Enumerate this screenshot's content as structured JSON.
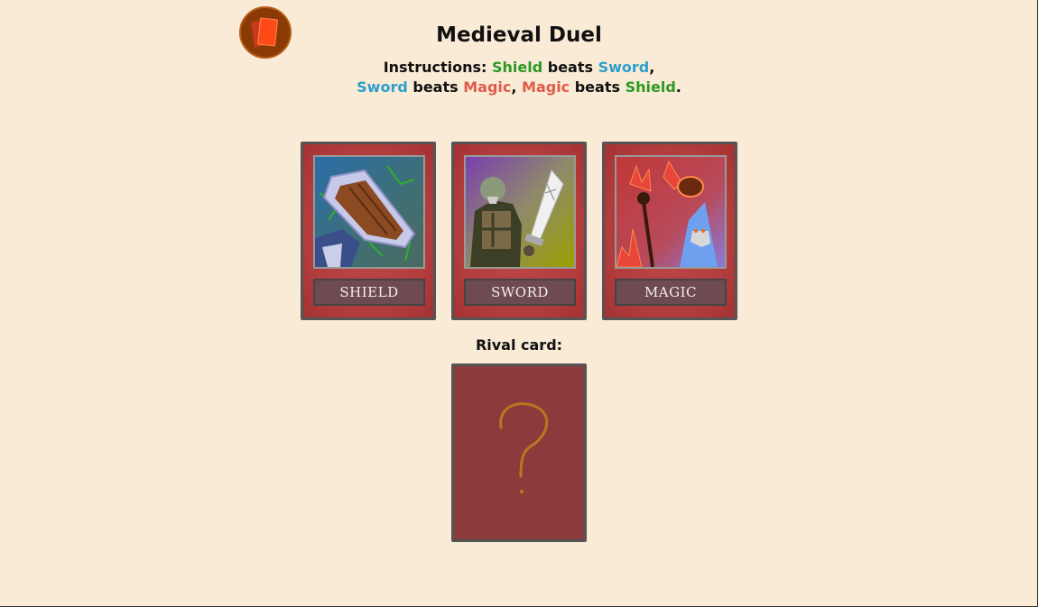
{
  "app": {
    "title": "Medieval Duel"
  },
  "instructions": {
    "prefix": "Instructions:",
    "line1": [
      {
        "text": "Shield",
        "kind": "shield"
      },
      {
        "text": " beats ",
        "kind": "plain"
      },
      {
        "text": "Sword",
        "kind": "sword"
      },
      {
        "text": ",",
        "kind": "plain"
      }
    ],
    "line2": [
      {
        "text": "Sword",
        "kind": "sword"
      },
      {
        "text": " beats ",
        "kind": "plain"
      },
      {
        "text": "Magic",
        "kind": "magic"
      },
      {
        "text": ", ",
        "kind": "plain"
      },
      {
        "text": "Magic",
        "kind": "magic"
      },
      {
        "text": " beats ",
        "kind": "plain"
      },
      {
        "text": "Shield",
        "kind": "shield"
      },
      {
        "text": ".",
        "kind": "plain"
      }
    ]
  },
  "colors": {
    "shield": "#2a9a22",
    "sword": "#2d9fcc",
    "magic": "#e05a4a",
    "background": "#faebd7",
    "card": "#b23b3c",
    "rival_card": "#8b3b3c"
  },
  "cards": [
    {
      "id": "shield",
      "label": "SHIELD",
      "icon": "shield-icon"
    },
    {
      "id": "sword",
      "label": "SWORD",
      "icon": "sword-icon"
    },
    {
      "id": "magic",
      "label": "MAGIC",
      "icon": "magic-icon"
    }
  ],
  "rival": {
    "label": "Rival card:",
    "icon": "question-mark-icon"
  },
  "logo": {
    "icon": "cards-logo-icon"
  }
}
